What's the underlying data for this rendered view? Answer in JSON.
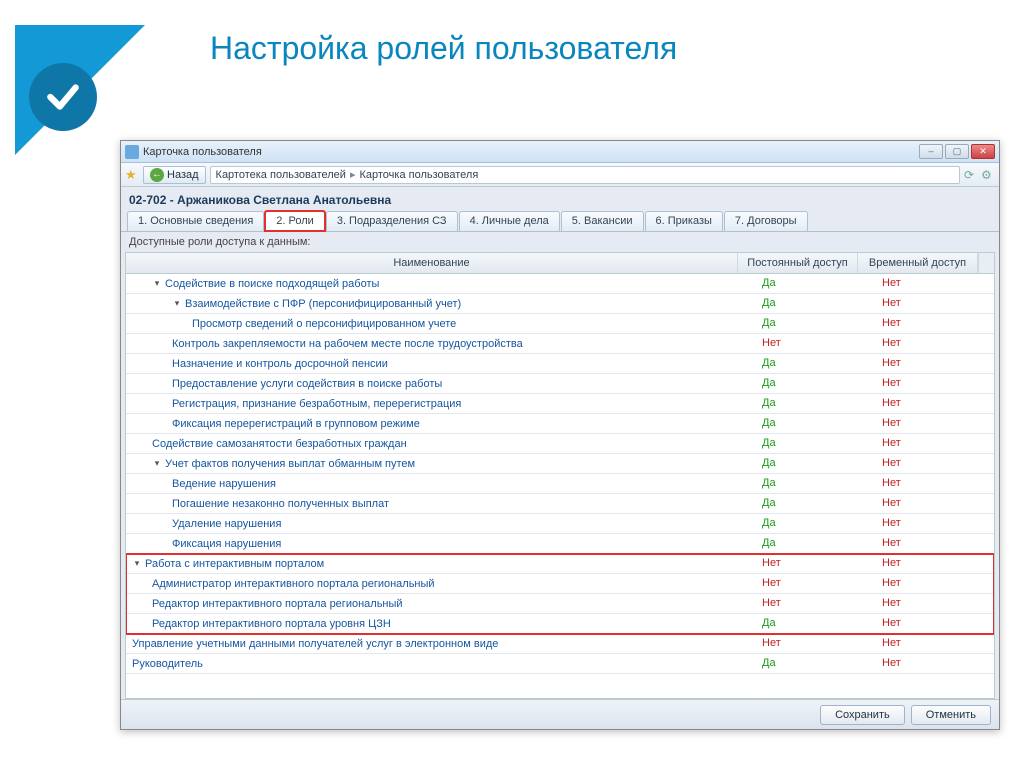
{
  "slide": {
    "title": "Настройка ролей пользователя"
  },
  "window": {
    "title": "Карточка пользователя",
    "back_label": "Назад",
    "breadcrumb_1": "Картотека пользователей",
    "breadcrumb_2": "Карточка пользователя"
  },
  "card": {
    "header": "02-702 - Аржаникова Светлана Анатольевна",
    "subheader": "Доступные роли доступа к данным:"
  },
  "tabs": [
    {
      "label": "1. Основные сведения"
    },
    {
      "label": "2. Роли"
    },
    {
      "label": "3. Подразделения СЗ"
    },
    {
      "label": "4. Личные дела"
    },
    {
      "label": "5. Вакансии"
    },
    {
      "label": "6. Приказы"
    },
    {
      "label": "7. Договоры"
    }
  ],
  "columns": {
    "name": "Наименование",
    "perm": "Постоянный доступ",
    "temp": "Временный доступ"
  },
  "rows": [
    {
      "indent": 1,
      "toggle": "▾",
      "name": "Содействие в поиске подходящей работы",
      "perm": "Да",
      "temp": "Нет"
    },
    {
      "indent": 2,
      "toggle": "▾",
      "name": "Взаимодействие с ПФР (персонифицированный учет)",
      "perm": "Да",
      "temp": "Нет"
    },
    {
      "indent": 3,
      "toggle": "",
      "name": "Просмотр сведений о персонифицированном учете",
      "perm": "Да",
      "temp": "Нет"
    },
    {
      "indent": 2,
      "toggle": "",
      "name": "Контроль закрепляемости на рабочем месте после трудоустройства",
      "perm": "Нет",
      "temp": "Нет"
    },
    {
      "indent": 2,
      "toggle": "",
      "name": "Назначение и контроль досрочной пенсии",
      "perm": "Да",
      "temp": "Нет"
    },
    {
      "indent": 2,
      "toggle": "",
      "name": "Предоставление услуги содействия в поиске работы",
      "perm": "Да",
      "temp": "Нет"
    },
    {
      "indent": 2,
      "toggle": "",
      "name": "Регистрация, признание безработным, перерегистрация",
      "perm": "Да",
      "temp": "Нет"
    },
    {
      "indent": 2,
      "toggle": "",
      "name": "Фиксация перерегистраций в групповом режиме",
      "perm": "Да",
      "temp": "Нет"
    },
    {
      "indent": 1,
      "toggle": "",
      "name": "Содействие самозанятости безработных граждан",
      "perm": "Да",
      "temp": "Нет"
    },
    {
      "indent": 1,
      "toggle": "▾",
      "name": "Учет фактов получения выплат обманным путем",
      "perm": "Да",
      "temp": "Нет"
    },
    {
      "indent": 2,
      "toggle": "",
      "name": "Ведение нарушения",
      "perm": "Да",
      "temp": "Нет"
    },
    {
      "indent": 2,
      "toggle": "",
      "name": "Погашение незаконно полученных выплат",
      "perm": "Да",
      "temp": "Нет"
    },
    {
      "indent": 2,
      "toggle": "",
      "name": "Удаление нарушения",
      "perm": "Да",
      "temp": "Нет"
    },
    {
      "indent": 2,
      "toggle": "",
      "name": "Фиксация нарушения",
      "perm": "Да",
      "temp": "Нет"
    },
    {
      "indent": 0,
      "toggle": "▾",
      "name": "Работа с интерактивным порталом",
      "perm": "Нет",
      "temp": "Нет",
      "hl": true
    },
    {
      "indent": 1,
      "toggle": "",
      "name": "Администратор интерактивного портала региональный",
      "perm": "Нет",
      "temp": "Нет",
      "hl": true
    },
    {
      "indent": 1,
      "toggle": "",
      "name": "Редактор интерактивного портала региональный",
      "perm": "Нет",
      "temp": "Нет",
      "hl": true
    },
    {
      "indent": 1,
      "toggle": "",
      "name": "Редактор интерактивного портала уровня ЦЗН",
      "perm": "Да",
      "temp": "Нет",
      "hl": true
    },
    {
      "indent": 0,
      "toggle": "",
      "name": "Управление учетными данными получателей услуг в электронном виде",
      "perm": "Нет",
      "temp": "Нет"
    },
    {
      "indent": 0,
      "toggle": "",
      "name": "Руководитель",
      "perm": "Да",
      "temp": "Нет"
    }
  ],
  "footer": {
    "save": "Сохранить",
    "cancel": "Отменить"
  }
}
